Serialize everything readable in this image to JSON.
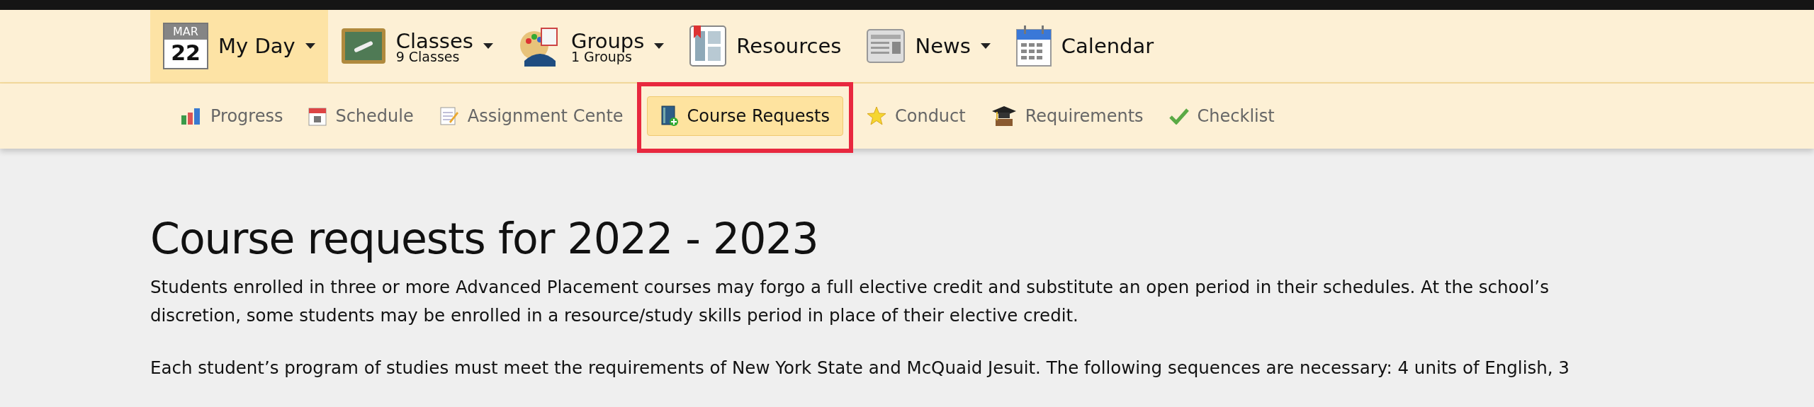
{
  "top_nav": [
    {
      "kind": "date",
      "month": "MAR",
      "day": "22",
      "label": "My Day",
      "dropdown": true,
      "selected": true
    },
    {
      "kind": "board",
      "label": "Classes",
      "sublabel": "9 Classes",
      "dropdown": true,
      "selected": false
    },
    {
      "kind": "palette",
      "label": "Groups",
      "sublabel": "1 Groups",
      "dropdown": true,
      "selected": false
    },
    {
      "kind": "book",
      "label": "Resources",
      "dropdown": false,
      "selected": false
    },
    {
      "kind": "newspaper",
      "label": "News",
      "dropdown": true,
      "selected": false
    },
    {
      "kind": "calendar",
      "label": "Calendar",
      "dropdown": false,
      "selected": false
    }
  ],
  "sub_nav": [
    {
      "kind": "chart",
      "label": "Progress",
      "selected": false,
      "highlighted": false
    },
    {
      "kind": "schedule",
      "label": "Schedule",
      "selected": false,
      "highlighted": false
    },
    {
      "kind": "notepad",
      "label": "Assignment Cente",
      "selected": false,
      "highlighted": false
    },
    {
      "kind": "binder",
      "label": "Course Requests",
      "selected": true,
      "highlighted": true
    },
    {
      "kind": "star",
      "label": "Conduct",
      "selected": false,
      "highlighted": false
    },
    {
      "kind": "cap",
      "label": "Requirements",
      "selected": false,
      "highlighted": false
    },
    {
      "kind": "check",
      "label": "Checklist",
      "selected": false,
      "highlighted": false
    }
  ],
  "content": {
    "title": "Course requests for 2022 - 2023",
    "paragraphs": [
      "Students enrolled in three or more Advanced Placement courses may forgo a full elective credit and substitute an open period in their schedules. At the school’s discretion, some students may be enrolled in a resource/study skills period in place of their elective credit.",
      "Each student’s program of studies must meet the requirements of New York State and McQuaid Jesuit. The following sequences are necessary: 4 units of English, 3"
    ]
  }
}
